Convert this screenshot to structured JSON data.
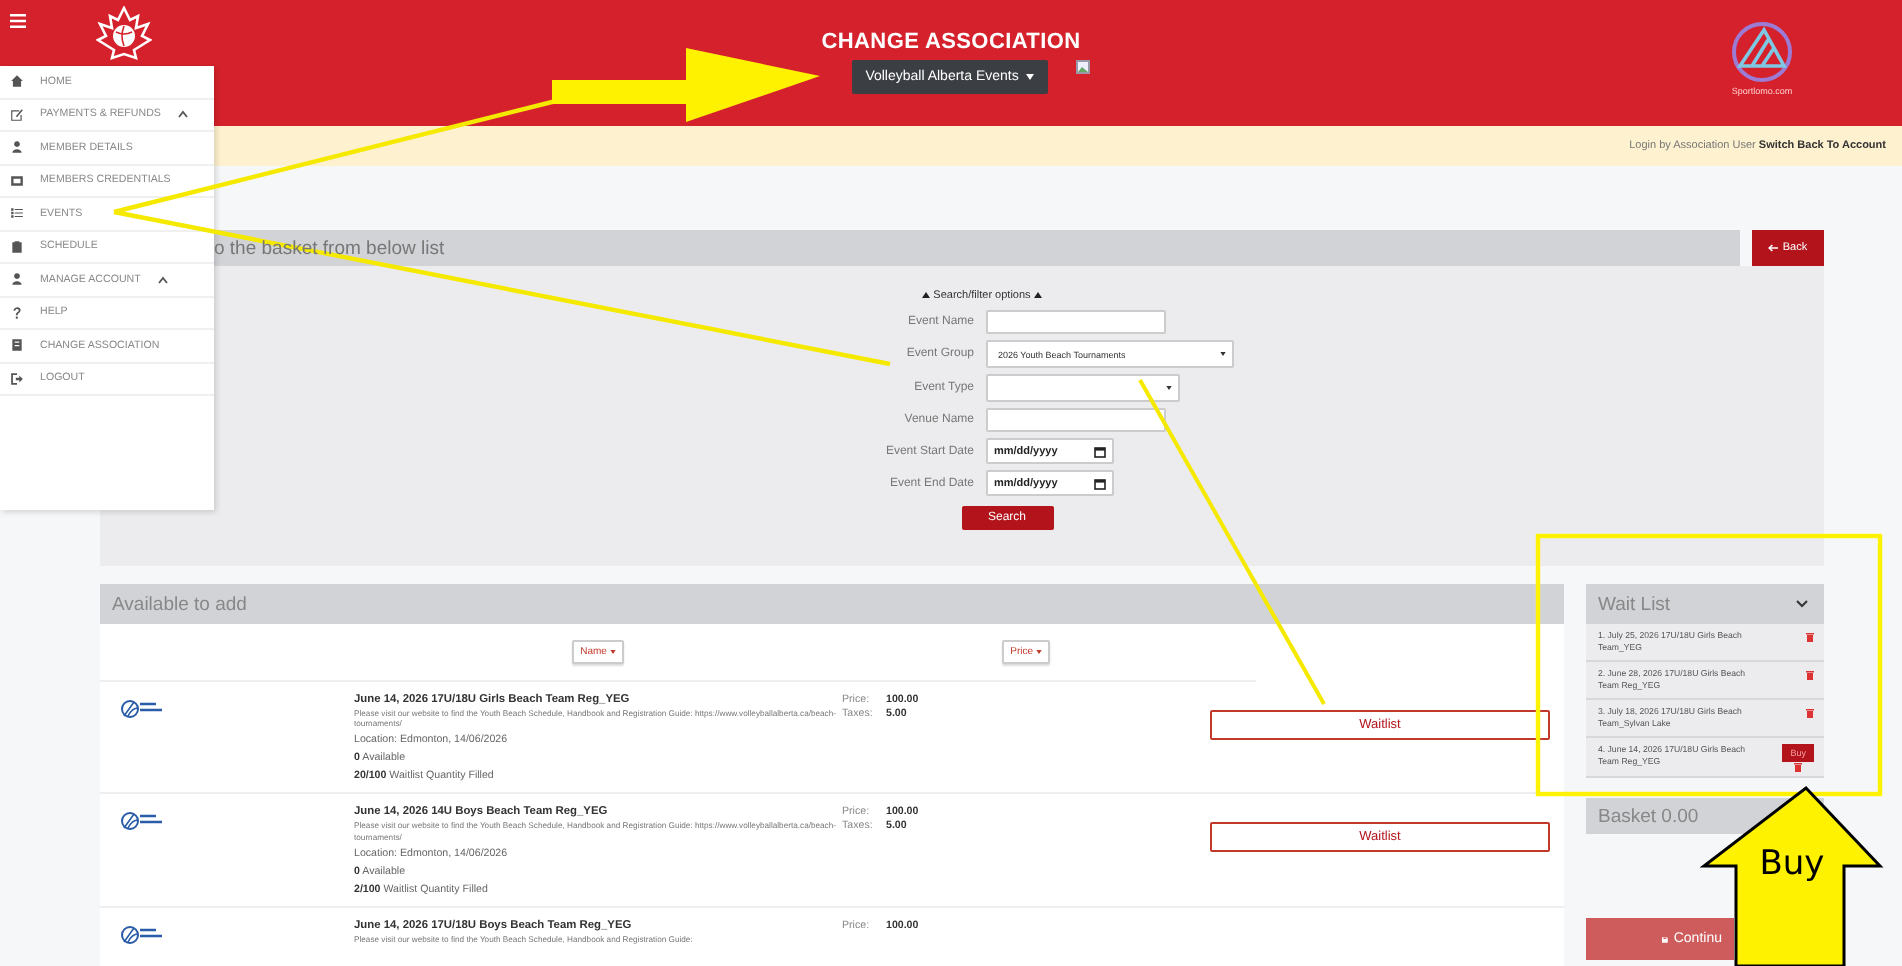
{
  "header": {
    "title": "CHANGE ASSOCIATION",
    "association_dropdown": "Volleyball Alberta Events",
    "brand_caption": "Sportlomo.com"
  },
  "notice": {
    "text": "Login by Association User",
    "link": "Switch Back To Account"
  },
  "sidebar": {
    "items": [
      {
        "label": "HOME",
        "kind": "link"
      },
      {
        "label": "PAYMENTS & REFUNDS",
        "kind": "group",
        "expanded": true
      },
      {
        "label": "MEMBER DETAILS",
        "kind": "link"
      },
      {
        "label": "MEMBERS CREDENTIALS",
        "kind": "link"
      },
      {
        "label": "EVENTS",
        "kind": "link"
      },
      {
        "label": "SCHEDULE",
        "kind": "link"
      },
      {
        "label": "MANAGE ACCOUNT",
        "kind": "group",
        "expanded": true
      },
      {
        "label": "HELP",
        "kind": "link"
      },
      {
        "label": "CHANGE ASSOCIATION",
        "kind": "link"
      },
      {
        "label": "LOGOUT",
        "kind": "link"
      }
    ]
  },
  "page": {
    "heading": "o the basket from below list",
    "back_button": "Back"
  },
  "search": {
    "toggle": "Search/filter options",
    "fields": [
      {
        "label": "Event Name",
        "kind": "text"
      },
      {
        "label": "Event Group",
        "kind": "select",
        "value": "2026 Youth Beach Tournaments"
      },
      {
        "label": "Event Type",
        "kind": "select"
      },
      {
        "label": "Venue Name",
        "kind": "text"
      },
      {
        "label": "Event Start Date",
        "kind": "date",
        "placeholder": "mm/dd/yyyy"
      },
      {
        "label": "Event End Date",
        "kind": "date",
        "placeholder": "mm/dd/yyyy"
      }
    ],
    "button": "Search"
  },
  "available": {
    "title": "Available to add",
    "sort_buttons": [
      "Name",
      "Price"
    ],
    "rows": [
      {
        "title": "June 14, 2026 17U/18U Girls Beach Team Reg_YEG",
        "description": "Please visit our website to find the Youth Beach Schedule, Handbook and Registration Guide: https://www.volleyballalberta.ca/beach-tournaments/",
        "location": "Location: Edmonton, 14/06/2026",
        "availability": "**0** Available",
        "waitlist_filled": "**20/100** Waitlist Quantity Filled",
        "price_label": "Price:",
        "price": "100.00",
        "taxes_label": "Taxes:",
        "taxes": "5.00",
        "button": "Waitlist"
      },
      {
        "title": "June 14, 2026 14U Boys Beach Team Reg_YEG",
        "description": "Please visit our website to find the Youth Beach Schedule, Handbook and Registration Guide: https://www.volleyballalberta.ca/beach-tournaments/",
        "location": "Location: Edmonton, 14/06/2026",
        "availability": "**0** Available",
        "waitlist_filled": "**2/100** Waitlist Quantity Filled",
        "price_label": "Price:",
        "price": "100.00",
        "taxes_label": "Taxes:",
        "taxes": "5.00",
        "button": "Waitlist"
      },
      {
        "title": "June 14, 2026 17U/18U Boys Beach Team Reg_YEG",
        "description": "Please visit our website to find the Youth Beach Schedule, Handbook and Registration Guide:",
        "price_label": "Price:",
        "price": "100.00"
      }
    ]
  },
  "wait_list": {
    "title": "Wait List",
    "items": [
      {
        "text": "1. July 25, 2026 17U/18U Girls Beach Team_YEG",
        "kind": "remove"
      },
      {
        "text": "2. June 28, 2026 17U/18U Girls Beach Team Reg_YEG",
        "kind": "remove"
      },
      {
        "text": "3. July 18, 2026 17U/18U Girls Beach Team_Sylvan Lake",
        "kind": "remove"
      },
      {
        "text": "4. June 14, 2026 17U/18U Girls Beach Team Reg_YEG",
        "kind": "buy",
        "button": "Buy"
      }
    ]
  },
  "basket": {
    "title": "Basket 0.00",
    "button": "Continu"
  },
  "annotations": {
    "callout": "Buy"
  }
}
